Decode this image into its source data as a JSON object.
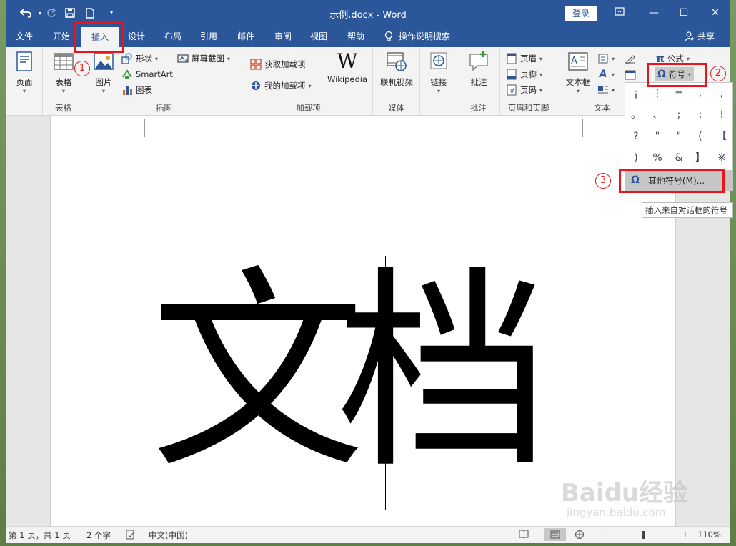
{
  "titlebar": {
    "title": "示例.docx  -  Word",
    "login": "登录"
  },
  "tabs": [
    "文件",
    "开始",
    "插入",
    "设计",
    "布局",
    "引用",
    "邮件",
    "审阅",
    "视图",
    "帮助"
  ],
  "tell_me": "操作说明搜索",
  "share": "共享",
  "ribbon": {
    "pages": {
      "label": "页面",
      "group": ""
    },
    "tables": {
      "label": "表格",
      "group": "表格"
    },
    "illustrations": {
      "group": "插图",
      "pictures": "图片",
      "shapes": "形状",
      "smartart": "SmartArt",
      "chart": "图表",
      "screenshot": "屏幕截图"
    },
    "addins": {
      "group": "加载项",
      "get": "获取加载项",
      "my": "我的加载项",
      "wikipedia": "Wikipedia"
    },
    "media": {
      "group": "媒体",
      "online_video": "联机视频"
    },
    "links": {
      "group": "",
      "label": "链接"
    },
    "comments": {
      "group": "批注",
      "label": "批注"
    },
    "header_footer": {
      "group": "页眉和页脚",
      "header": "页眉",
      "footer": "页脚",
      "page_number": "页码"
    },
    "text": {
      "group": "文本",
      "textbox": "文本框"
    },
    "symbols": {
      "equation": "公式",
      "symbol": "符号"
    }
  },
  "document": {
    "char1": "文",
    "char2": "档"
  },
  "symbol_menu": {
    "symbols": [
      "¡",
      "⋮",
      "═",
      ",",
      ",",
      "。",
      "、",
      ";",
      ":",
      "!",
      "?",
      "\"",
      "\"",
      "(",
      "【",
      ")",
      "%",
      "&",
      "】",
      "※"
    ],
    "more": "其他符号(M)...",
    "tooltip": "插入来自对话框的符号"
  },
  "annotations": {
    "one": "1",
    "two": "2",
    "three": "3"
  },
  "status": {
    "page": "第 1 页，共 1 页",
    "words": "2 个字",
    "language": "中文(中国)",
    "zoom": "110%"
  },
  "watermark": {
    "brand": "Baidu经验",
    "url": "jingyan.baidu.com"
  },
  "colors": {
    "accent": "#2b579a",
    "annotation": "#e8151b"
  }
}
